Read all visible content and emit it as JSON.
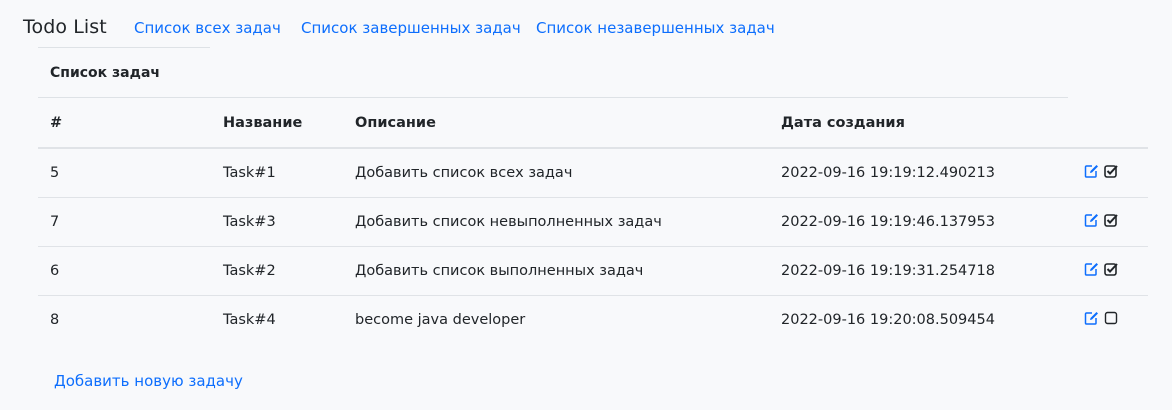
{
  "nav": {
    "brand": "Todo List",
    "links": [
      "Список всех задач",
      "Список завершенных задач",
      "Список незавершенных задач"
    ]
  },
  "card": {
    "title": "Список задач"
  },
  "table": {
    "headers": [
      "#",
      "Название",
      "Описание",
      "Дата создания"
    ],
    "rows": [
      {
        "id": "5",
        "name": "Task#1",
        "description": "Добавить список всех задач",
        "created": "2022-09-16 19:19:12.490213",
        "done": true
      },
      {
        "id": "7",
        "name": "Task#3",
        "description": "Добавить список невыполненных задач",
        "created": "2022-09-16 19:19:46.137953",
        "done": true
      },
      {
        "id": "6",
        "name": "Task#2",
        "description": "Добавить список выполненных задач",
        "created": "2022-09-16 19:19:31.254718",
        "done": true
      },
      {
        "id": "8",
        "name": "Task#4",
        "description": "become java developer",
        "created": "2022-09-16 19:20:08.509454",
        "done": false
      }
    ]
  },
  "actions": {
    "edit_icon": "edit-icon",
    "check_icon": "checkbox-icon"
  },
  "footer": {
    "add_link": "Добавить новую задачу"
  },
  "colors": {
    "link": "#0d6efd",
    "text": "#212529",
    "border": "#dee2e6",
    "background": "#f8f9fb"
  }
}
